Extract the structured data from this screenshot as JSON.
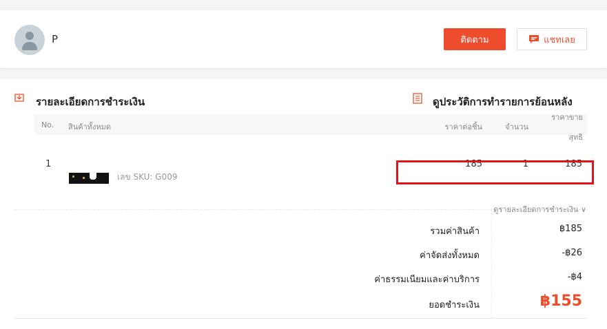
{
  "header": {
    "shop_name": "P",
    "follow_label": "ติดตาม",
    "chat_label": "แชทเลย"
  },
  "payment_section": {
    "title": "รายละเอียดการชำระเงิน",
    "history_link": "ดูประวัติการทำรายการย้อนหลัง"
  },
  "table": {
    "headers": {
      "no": "No.",
      "product": "สินค้าทั้งหมด",
      "unit_price": "ราคาต่อชิ้น",
      "qty": "จำนวน",
      "net_line1": "ราคาขาย",
      "net_line2": "สุทธิ"
    },
    "rows": [
      {
        "no": "1",
        "sku": "เลข SKU: G009",
        "unit_price": "185",
        "qty": "1",
        "net": "185"
      }
    ]
  },
  "summary": {
    "toggle_label": "ดูรายละเอียดการชำระเงิน",
    "rows": [
      {
        "label": "รวมค่าสินค้า",
        "value": "฿185"
      },
      {
        "label": "ค่าจัดส่งทั้งหมด",
        "value": "-฿26"
      },
      {
        "label": "ค่าธรรมเนียมและค่าบริการ",
        "value": "-฿4"
      }
    ],
    "total_label": "ยอดชำระเงิน",
    "total_value": "฿155"
  },
  "colors": {
    "accent": "#ee4d2d",
    "highlight": "#e3131b"
  }
}
